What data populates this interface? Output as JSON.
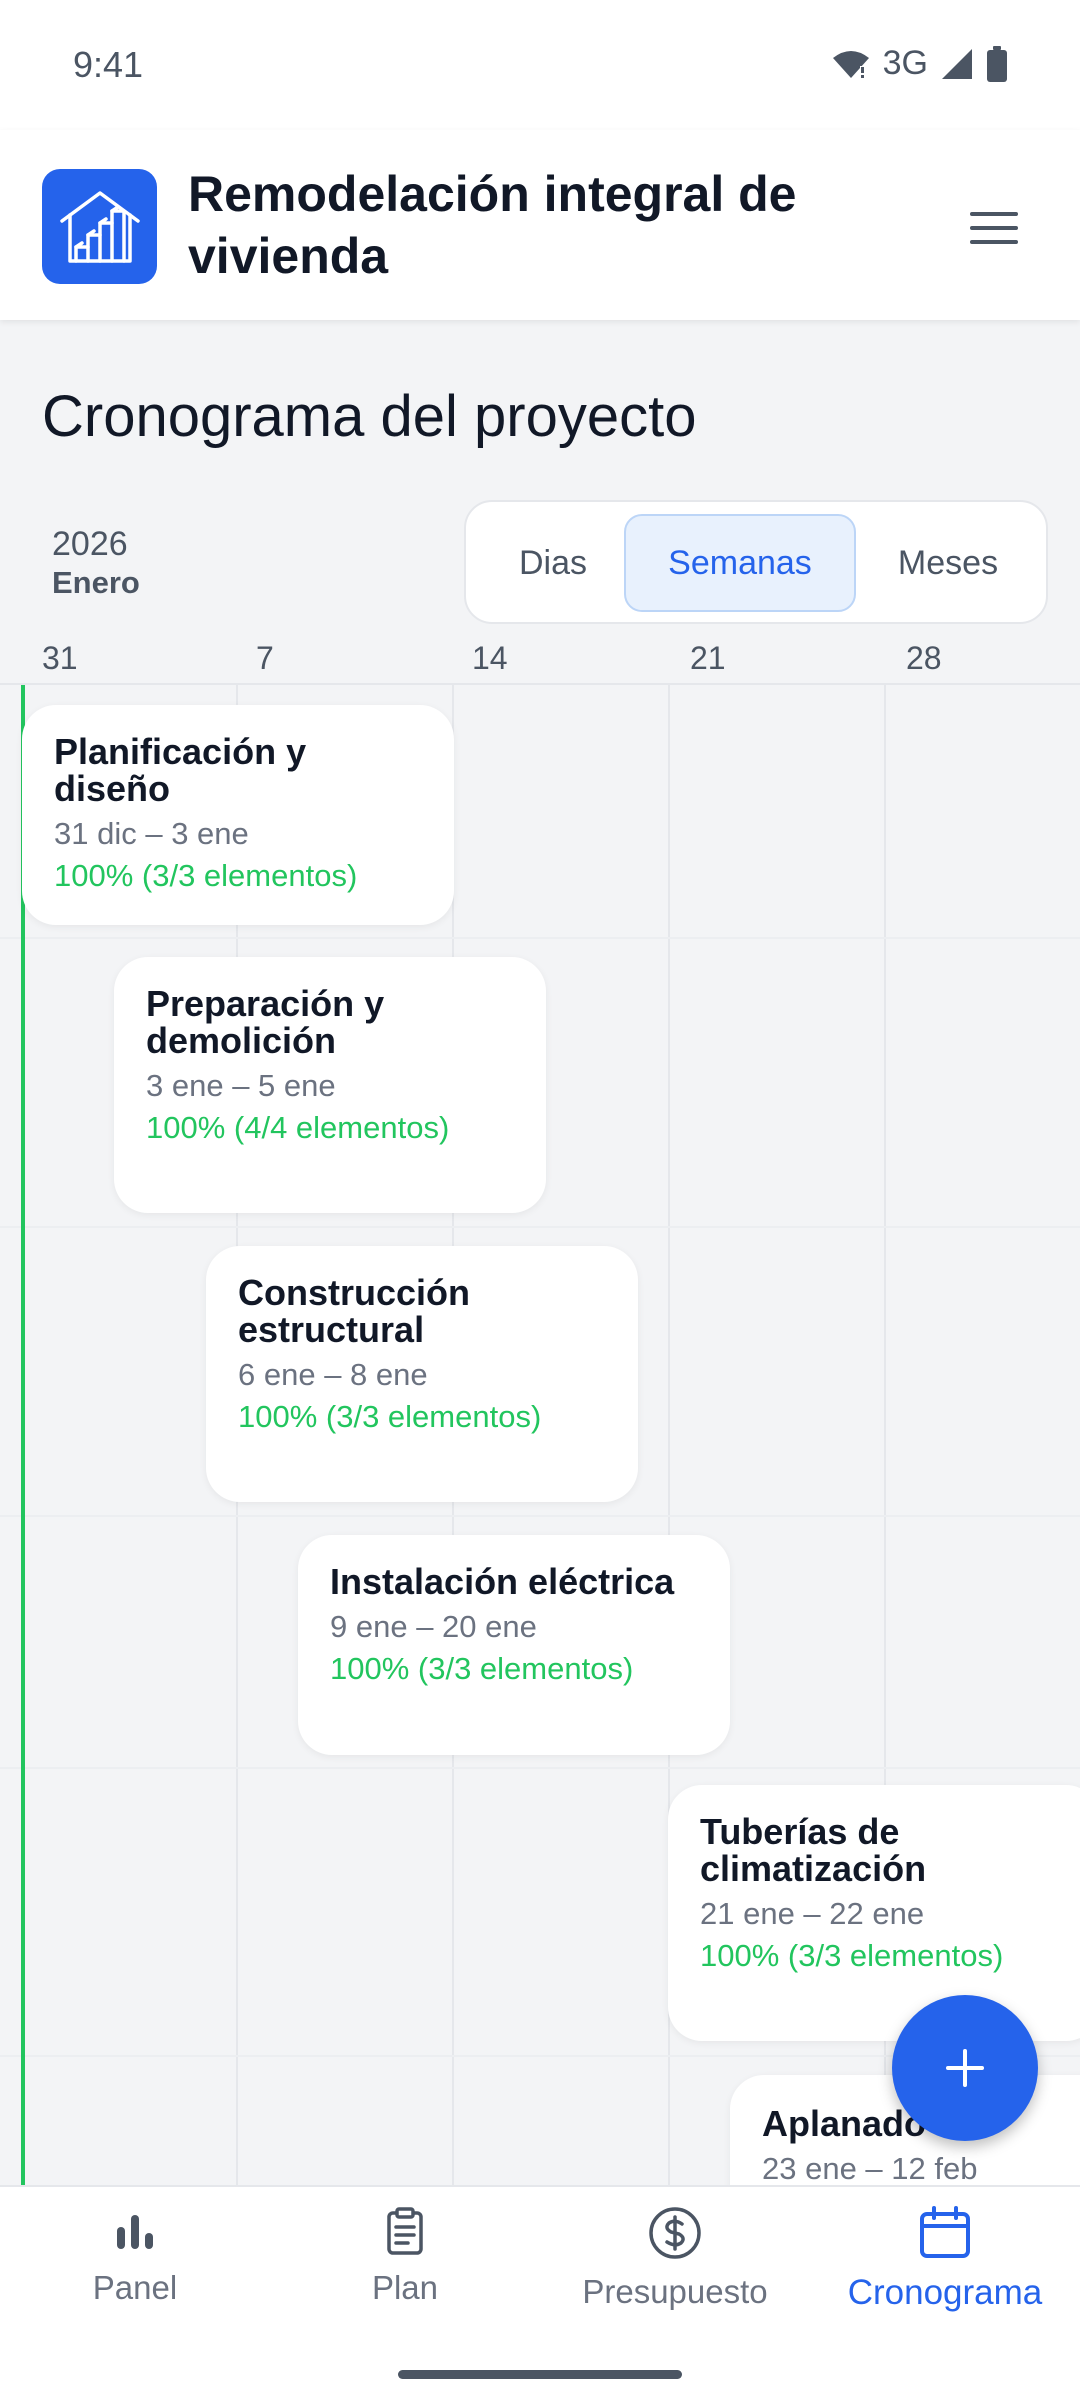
{
  "status_bar": {
    "time": "9:41",
    "network": "3G"
  },
  "header": {
    "title": "Remodelación integral de vivienda"
  },
  "page": {
    "title": "Cronograma del proyecto"
  },
  "timeline": {
    "year": "2026",
    "month": "Enero",
    "view_options": [
      "Dias",
      "Semanas",
      "Meses"
    ],
    "selected_view": "Semanas",
    "ticks": [
      "31",
      "7",
      "14",
      "21",
      "28"
    ],
    "phases": [
      {
        "title": "Planificación y diseño",
        "dates": "31 dic – 3 ene",
        "progress": "100% (3/3 elementos)"
      },
      {
        "title": "Preparación y demolición",
        "dates": "3 ene – 5 ene",
        "progress": "100% (4/4 elementos)"
      },
      {
        "title": "Construcción estructural",
        "dates": "6 ene – 8 ene",
        "progress": "100% (3/3 elementos)"
      },
      {
        "title": "Instalación eléctrica",
        "dates": "9 ene – 20 ene",
        "progress": "100% (3/3 elementos)"
      },
      {
        "title": "Tuberías de climatización",
        "dates": "21 ene – 22 ene",
        "progress": "100% (3/3 elementos)"
      },
      {
        "title": "Aplanado",
        "dates": "23 ene – 12 feb",
        "progress": ""
      }
    ]
  },
  "fab": {
    "icon": "plus-icon"
  },
  "bottom_nav": {
    "items": [
      {
        "label": "Panel",
        "icon": "bar-chart-icon"
      },
      {
        "label": "Plan",
        "icon": "clipboard-icon"
      },
      {
        "label": "Presupuesto",
        "icon": "dollar-icon"
      },
      {
        "label": "Cronograma",
        "icon": "calendar-icon"
      }
    ],
    "active": "Cronograma"
  },
  "colors": {
    "accent": "#2563eb",
    "progress": "#22c55e",
    "today_line": "#22c55e"
  }
}
